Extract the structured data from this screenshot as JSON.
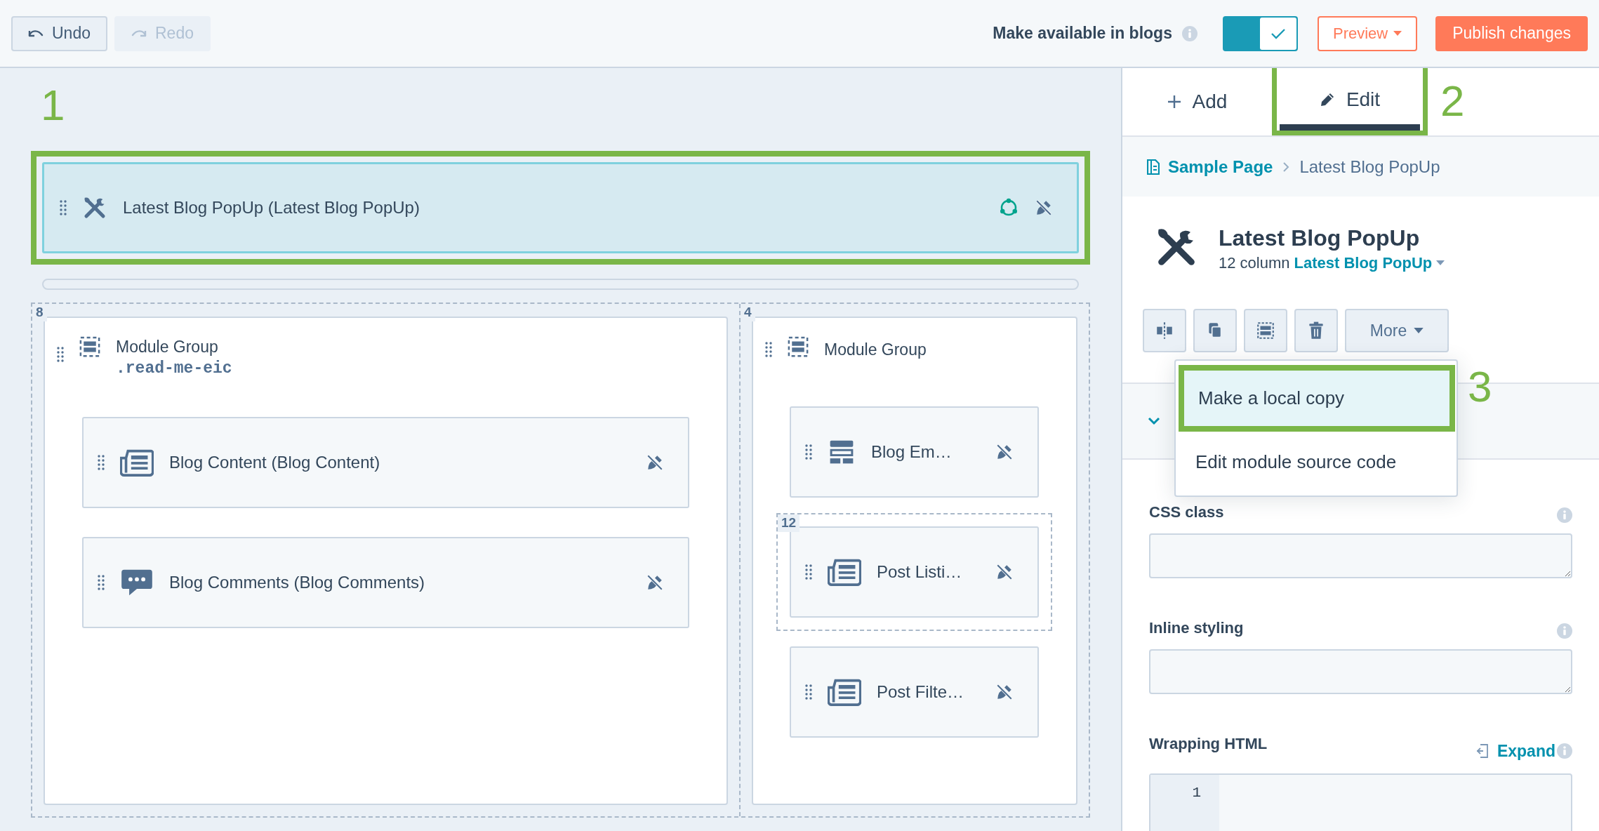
{
  "toolbar": {
    "undo": {
      "label": "Undo",
      "disabled": false
    },
    "redo": {
      "label": "Redo",
      "disabled": true
    },
    "blog_toggle": {
      "label": "Make available in blogs",
      "on": true
    },
    "preview": {
      "label": "Preview"
    },
    "publish": {
      "label": "Publish changes"
    }
  },
  "canvas": {
    "callout": "1",
    "selected_module": {
      "label": "Latest Blog PopUp (Latest Blog PopUp)",
      "selected": true
    },
    "columns": [
      {
        "span": "8",
        "group": {
          "title": "Module Group",
          "css_class": ".read-me-eic"
        },
        "modules": [
          {
            "label": "Blog Content (Blog Content)",
            "kind": "listing"
          },
          {
            "label": "Blog Comments (Blog Comments)",
            "kind": "comment"
          }
        ]
      },
      {
        "span": "4",
        "group": {
          "title": "Module Group"
        },
        "modules": [
          {
            "label": "Blog Em…",
            "kind": "layout"
          },
          {
            "label": "Post Listi…",
            "kind": "listing",
            "span": "12"
          },
          {
            "label": "Post Filte…",
            "kind": "listing"
          }
        ]
      }
    ]
  },
  "sidebar": {
    "tabs": [
      {
        "label": "Add",
        "kind": "add",
        "selected": false
      },
      {
        "label": "Edit",
        "kind": "edit",
        "selected": true
      }
    ],
    "tabs_callout": "2",
    "breadcrumb": [
      {
        "label": "Sample Page"
      },
      {
        "label": "Latest Blog PopUp"
      }
    ],
    "module": {
      "title": "Latest Blog PopUp",
      "width": "12 column",
      "template": "Latest Blog PopUp"
    },
    "actions": {
      "more": "More"
    },
    "menu": {
      "items": [
        {
          "label": "Make a local copy",
          "selected": true
        },
        {
          "label": "Edit module source code",
          "selected": false
        }
      ],
      "callout": "3"
    },
    "fields": [
      {
        "label": "CSS class",
        "kind": "textarea"
      },
      {
        "label": "Inline styling",
        "kind": "textarea"
      },
      {
        "label": "Wrapping HTML",
        "kind": "code",
        "action": "Expand",
        "line_numbers": [
          "1"
        ]
      }
    ]
  }
}
